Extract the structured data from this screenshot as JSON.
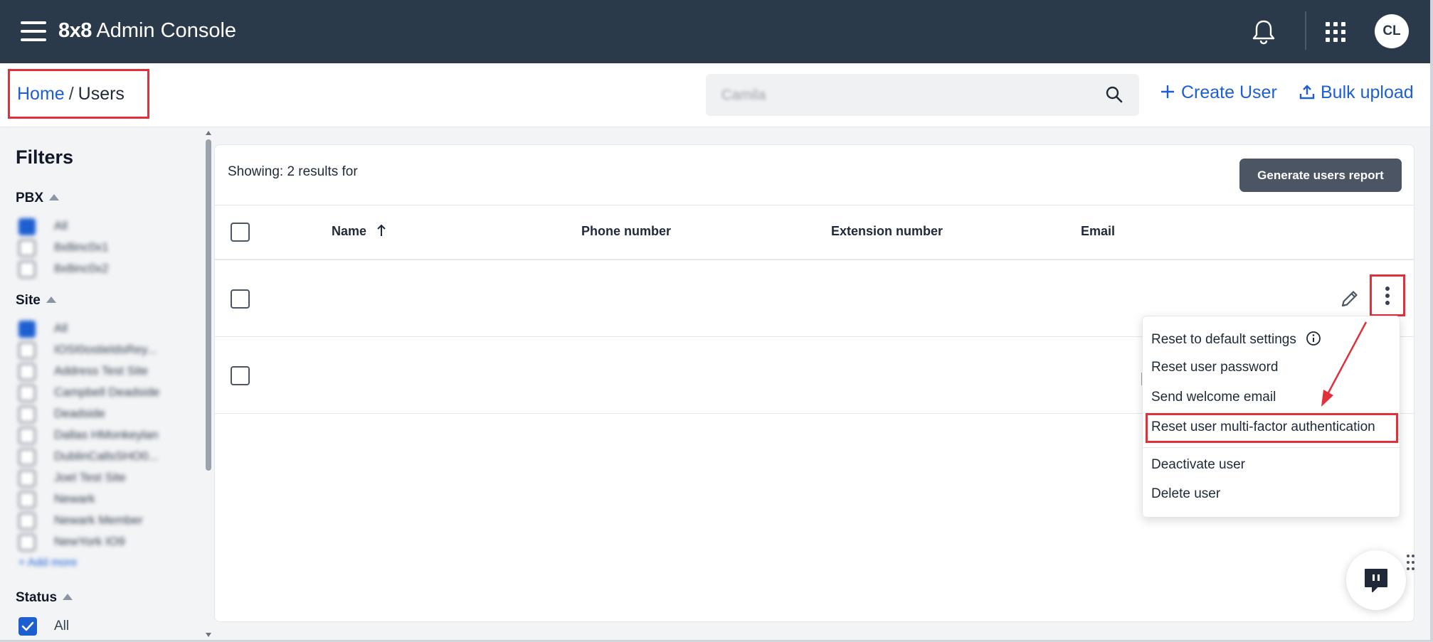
{
  "header": {
    "brand_logo": "8x8",
    "brand_title": "Admin Console",
    "avatar_initials": "CL"
  },
  "breadcrumb": {
    "home": "Home",
    "separator": "/",
    "current": "Users"
  },
  "search": {
    "value": "Camila"
  },
  "actions": {
    "create_user": "Create User",
    "bulk_upload": "Bulk upload"
  },
  "filters": {
    "title": "Filters",
    "pbx": {
      "label": "PBX",
      "options": [
        {
          "label": "All",
          "checked": true
        },
        {
          "label": "8x8inc0x1",
          "checked": false
        },
        {
          "label": "8x8inc0x2",
          "checked": false
        }
      ]
    },
    "site": {
      "label": "Site",
      "options": [
        {
          "label": "All",
          "checked": true
        },
        {
          "label": "IOSI0ostieldsRey...",
          "checked": false
        },
        {
          "label": "Address Test Site",
          "checked": false
        },
        {
          "label": "Campbell Deadside",
          "checked": false
        },
        {
          "label": "Deadside",
          "checked": false
        },
        {
          "label": "Dallas HMonkeylan",
          "checked": false
        },
        {
          "label": "DublinCallsSHO0...",
          "checked": false
        },
        {
          "label": "Joel Test Site",
          "checked": false
        },
        {
          "label": "Newark",
          "checked": false
        },
        {
          "label": "Newark Member",
          "checked": false
        },
        {
          "label": "NewYork IO9",
          "checked": false
        }
      ],
      "add_more": "+ Add more"
    },
    "status": {
      "label": "Status",
      "all_label": "All",
      "all_checked": true
    }
  },
  "results": {
    "showing_text": "Showing: 2 results for",
    "generate_report": "Generate users report"
  },
  "table": {
    "columns": [
      "Name",
      "Phone number",
      "Extension number",
      "Email"
    ],
    "sorted_column": "Name",
    "sort_direction": "ascending",
    "row_count": 2
  },
  "row_menu": {
    "items": [
      "Reset to default settings",
      "Reset user password",
      "Send welcome email",
      "Reset user multi-factor authentication",
      "Deactivate user",
      "Delete user"
    ],
    "highlighted_item": "Reset user multi-factor authentication"
  },
  "icons": {
    "menu": "hamburger-icon",
    "notifications": "bell-icon",
    "apps": "grid-icon",
    "search": "search-icon",
    "create": "plus-icon",
    "upload": "upload-icon",
    "edit": "pencil-icon",
    "more": "kebab-icon",
    "info": "info-icon",
    "chat": "chat-icon"
  },
  "colors": {
    "header_bg": "#2b3a4b",
    "link": "#1d5fd1",
    "annotation": "#e0303a",
    "button_bg": "#4b5563"
  }
}
